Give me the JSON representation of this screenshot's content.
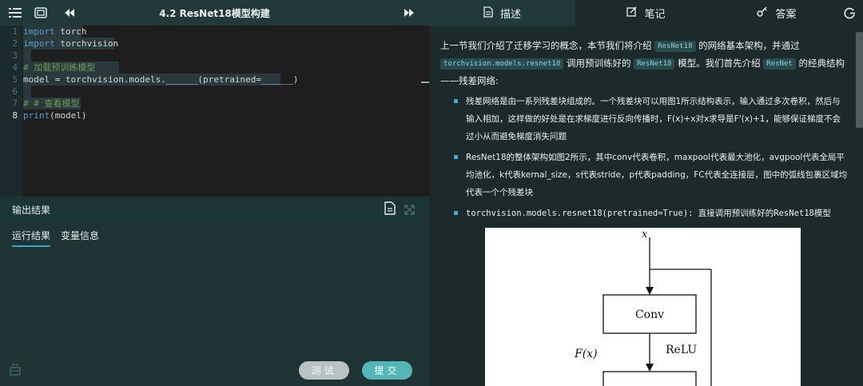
{
  "editor": {
    "title": "4.2 ResNet18模型构建",
    "lines": [
      {
        "n": "1",
        "parts": [
          [
            "kw",
            "import"
          ],
          [
            "",
            " torch"
          ]
        ]
      },
      {
        "n": "2",
        "parts": [
          [
            "kw",
            "import"
          ],
          [
            "",
            " torchvision"
          ]
        ]
      },
      {
        "n": "3",
        "parts": []
      },
      {
        "n": "4",
        "parts": [
          [
            "cm",
            "# 加载预训练模型"
          ]
        ]
      },
      {
        "n": "5",
        "parts": [
          [
            "",
            "model = torchvision.models.______(pretrained=______)"
          ]
        ]
      },
      {
        "n": "6",
        "parts": []
      },
      {
        "n": "7",
        "parts": [
          [
            "cm",
            "# # 查看模型"
          ]
        ]
      },
      {
        "n": "8",
        "parts": [
          [
            "fn",
            "print"
          ],
          [
            "",
            "(model)"
          ]
        ]
      }
    ]
  },
  "output": {
    "title": "输出结果",
    "tabs": [
      "运行结果",
      "变量信息"
    ]
  },
  "footer": {
    "test_label": "测试",
    "submit_label": "提交"
  },
  "right_tabs": [
    "描述",
    "笔记",
    "答案"
  ],
  "description": {
    "p1_a": "上一节我们介绍了迁移学习的概念，本节我们将介绍",
    "p1_chip1": "ResNet18",
    "p1_b": "的网络基本架构，并通过",
    "p1_chip2": "torchvision.models.resnet18",
    "p1_c": "调用预训练好的",
    "p1_chip3": "ResNet18",
    "p1_d": "模型。我们首先介绍",
    "p1_chip4": "ResNet",
    "p1_e": "的经典结构——残差网络:",
    "bullets": [
      "残差网络是由一系列残差块组成的。一个残差块可以用图1所示结构表示，输入通过多次卷积，然后与输入相加，这样做的好处是在求梯度进行反向传播时，F(x)+x对x求导是F'(x)+1，能够保证梯度不会过小从而避免梯度消失问题",
      "ResNet18的整体架构如图2所示，其中conv代表卷积，maxpool代表最大池化，avgpool代表全局平均池化，k代表kernal_size，s代表stride，p代表padding，FC代表全连接层，图中的弧线包裹区域均代表一个个残差块",
      "torchvision.models.resnet18(pretrained=True): 直接调用预训练好的ResNet18模型"
    ]
  },
  "figure": {
    "x_label": "x",
    "conv_label": "Conv",
    "relu_label": "ReLU",
    "fx_label": "F(x)"
  }
}
